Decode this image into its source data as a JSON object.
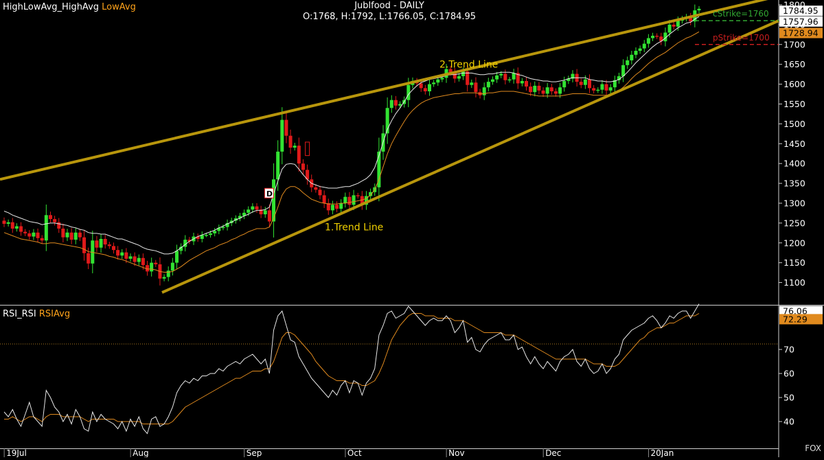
{
  "header": {
    "indicator_a": "HighLowAvg_HighAvg",
    "indicator_b": "LowAvg",
    "title": "Jublfood - DAILY",
    "ohlc": "O:1768, H:1792, L:1766.05, C:1784.95"
  },
  "rsi_panel": {
    "indicator_a": "RSI_RSI",
    "indicator_b": "RSIAvg"
  },
  "watermark": "FOX",
  "colors": {
    "background": "#000000",
    "bull": "#32e332",
    "bear": "#e01a1a",
    "trend_line": "#b8960c",
    "high_avg": "#e8e8e8",
    "low_avg": "#e08a1e",
    "rsi": "#e8e8e8",
    "rsi_avg": "#e08a1e",
    "call_strike": "#32a832",
    "put_strike": "#c81e1e"
  },
  "chart_data": [
    {
      "type": "candlestick",
      "title": "Jublfood - DAILY",
      "x_ticks": [
        "19Jul",
        "Aug",
        "Sep",
        "Oct",
        "Nov",
        "Dec",
        "20Jan"
      ],
      "y_ticks": [
        1100,
        1150,
        1200,
        1250,
        1300,
        1350,
        1400,
        1450,
        1500,
        1550,
        1600,
        1650,
        1700,
        1750,
        1800
      ],
      "ylim": [
        1064,
        1810
      ],
      "grid": false,
      "close_series": [
        1248,
        1252,
        1236,
        1242,
        1228,
        1224,
        1216,
        1226,
        1212,
        1206,
        1270,
        1260,
        1252,
        1236,
        1214,
        1226,
        1208,
        1226,
        1214,
        1174,
        1148,
        1206,
        1188,
        1210,
        1196,
        1192,
        1182,
        1168,
        1176,
        1160,
        1166,
        1152,
        1162,
        1144,
        1128,
        1150,
        1146,
        1110,
        1114,
        1130,
        1150,
        1180,
        1190,
        1208,
        1204,
        1216,
        1210,
        1220,
        1220,
        1224,
        1230,
        1238,
        1240,
        1250,
        1256,
        1262,
        1268,
        1276,
        1284,
        1292,
        1284,
        1272,
        1282,
        1254,
        1360,
        1430,
        1510,
        1470,
        1440,
        1445,
        1400,
        1384,
        1360,
        1340,
        1334,
        1320,
        1300,
        1282,
        1296,
        1286,
        1300,
        1316,
        1296,
        1320,
        1318,
        1296,
        1318,
        1328,
        1340,
        1430,
        1476,
        1540,
        1560,
        1546,
        1550,
        1560,
        1598,
        1608,
        1602,
        1590,
        1582,
        1600,
        1604,
        1612,
        1616,
        1638,
        1630,
        1614,
        1620,
        1632,
        1598,
        1604,
        1580,
        1572,
        1592,
        1606,
        1612,
        1622,
        1626,
        1610,
        1612,
        1628,
        1602,
        1608,
        1594,
        1580,
        1596,
        1584,
        1576,
        1592,
        1582,
        1576,
        1592,
        1608,
        1614,
        1626,
        1606,
        1598,
        1612,
        1590,
        1584,
        1586,
        1600,
        1584,
        1592,
        1610,
        1620,
        1648,
        1660,
        1674,
        1684,
        1690,
        1702,
        1716,
        1722,
        1720,
        1708,
        1730,
        1750,
        1745,
        1760,
        1765,
        1770,
        1758,
        1786,
        1790
      ],
      "high_avg": [
        1280,
        1276,
        1270,
        1266,
        1262,
        1258,
        1254,
        1252,
        1250,
        1246,
        1248,
        1250,
        1250,
        1248,
        1246,
        1244,
        1240,
        1238,
        1234,
        1232,
        1226,
        1224,
        1224,
        1222,
        1222,
        1218,
        1214,
        1210,
        1210,
        1206,
        1202,
        1198,
        1194,
        1188,
        1184,
        1182,
        1180,
        1176,
        1172,
        1172,
        1174,
        1180,
        1188,
        1196,
        1204,
        1210,
        1216,
        1220,
        1224,
        1228,
        1232,
        1238,
        1242,
        1248,
        1252,
        1258,
        1262,
        1268,
        1272,
        1278,
        1282,
        1282,
        1284,
        1290,
        1324,
        1356,
        1386,
        1398,
        1400,
        1398,
        1386,
        1372,
        1360,
        1350,
        1346,
        1342,
        1340,
        1338,
        1338,
        1338,
        1340,
        1342,
        1342,
        1346,
        1350,
        1356,
        1362,
        1372,
        1390,
        1420,
        1454,
        1486,
        1508,
        1526,
        1540,
        1556,
        1574,
        1586,
        1596,
        1604,
        1608,
        1612,
        1614,
        1616,
        1618,
        1622,
        1624,
        1624,
        1626,
        1628,
        1628,
        1628,
        1626,
        1624,
        1624,
        1626,
        1626,
        1628,
        1630,
        1630,
        1630,
        1628,
        1624,
        1622,
        1618,
        1614,
        1612,
        1610,
        1608,
        1608,
        1606,
        1606,
        1608,
        1610,
        1614,
        1616,
        1616,
        1616,
        1616,
        1612,
        1610,
        1608,
        1608,
        1606,
        1606,
        1608,
        1612,
        1620,
        1630,
        1642,
        1654,
        1664,
        1674,
        1684,
        1694,
        1702,
        1708,
        1716,
        1726,
        1734,
        1742,
        1748,
        1754,
        1756,
        1764,
        1770
      ],
      "low_avg": [
        1226,
        1222,
        1218,
        1214,
        1210,
        1208,
        1206,
        1204,
        1202,
        1198,
        1198,
        1200,
        1200,
        1198,
        1196,
        1194,
        1192,
        1190,
        1188,
        1184,
        1178,
        1176,
        1174,
        1172,
        1170,
        1166,
        1164,
        1160,
        1158,
        1154,
        1150,
        1146,
        1142,
        1138,
        1134,
        1134,
        1132,
        1128,
        1126,
        1126,
        1128,
        1134,
        1140,
        1148,
        1156,
        1162,
        1168,
        1174,
        1180,
        1184,
        1188,
        1194,
        1198,
        1202,
        1208,
        1212,
        1218,
        1222,
        1228,
        1232,
        1236,
        1236,
        1236,
        1240,
        1262,
        1290,
        1320,
        1336,
        1342,
        1342,
        1336,
        1326,
        1318,
        1310,
        1306,
        1302,
        1300,
        1298,
        1298,
        1298,
        1300,
        1300,
        1302,
        1304,
        1306,
        1308,
        1312,
        1320,
        1334,
        1360,
        1392,
        1424,
        1450,
        1470,
        1488,
        1506,
        1522,
        1534,
        1544,
        1552,
        1558,
        1562,
        1566,
        1568,
        1570,
        1572,
        1574,
        1576,
        1576,
        1578,
        1578,
        1578,
        1578,
        1576,
        1576,
        1578,
        1578,
        1580,
        1582,
        1582,
        1582,
        1582,
        1580,
        1578,
        1576,
        1574,
        1572,
        1570,
        1570,
        1570,
        1570,
        1570,
        1570,
        1572,
        1574,
        1576,
        1576,
        1576,
        1576,
        1574,
        1572,
        1572,
        1572,
        1572,
        1574,
        1578,
        1584,
        1592,
        1602,
        1614,
        1624,
        1632,
        1642,
        1652,
        1660,
        1668,
        1674,
        1680,
        1688,
        1696,
        1704,
        1710,
        1716,
        1720,
        1726,
        1732
      ]
    },
    {
      "type": "line",
      "series_a": "RSI_RSI",
      "series_b": "RSIAvg",
      "y_ticks": [
        40,
        50,
        60,
        70
      ],
      "ylim": [
        34,
        88
      ],
      "reference_level": 72.29,
      "rsi": [
        44,
        42,
        45,
        41,
        38,
        43,
        48,
        42,
        40,
        38,
        53,
        50,
        46,
        44,
        40,
        43,
        39,
        45,
        42,
        37,
        36,
        44,
        40,
        43,
        41,
        40,
        39,
        37,
        40,
        36,
        41,
        38,
        42,
        37,
        35,
        41,
        42,
        38,
        39,
        42,
        46,
        52,
        55,
        57,
        56,
        58,
        57,
        59,
        59,
        60,
        60,
        62,
        61,
        63,
        64,
        65,
        64,
        66,
        67,
        68,
        66,
        64,
        66,
        60,
        78,
        84,
        86,
        80,
        74,
        73,
        67,
        64,
        61,
        58,
        56,
        54,
        52,
        50,
        53,
        51,
        55,
        57,
        52,
        57,
        56,
        51,
        56,
        58,
        62,
        76,
        80,
        85,
        86,
        83,
        84,
        85,
        88,
        86,
        84,
        82,
        80,
        82,
        83,
        82,
        82,
        84,
        82,
        77,
        79,
        82,
        73,
        75,
        70,
        69,
        72,
        74,
        75,
        76,
        77,
        74,
        74,
        76,
        70,
        71,
        67,
        64,
        67,
        64,
        62,
        65,
        63,
        61,
        65,
        67,
        68,
        70,
        65,
        63,
        66,
        62,
        60,
        61,
        64,
        60,
        62,
        66,
        68,
        74,
        76,
        78,
        79,
        80,
        81,
        83,
        84,
        82,
        79,
        81,
        84,
        83,
        85,
        86,
        86,
        83,
        86,
        89
      ],
      "rsi_avg": [
        41,
        41,
        42,
        41,
        40,
        41,
        42,
        42,
        41,
        40,
        42,
        43,
        43,
        43,
        42,
        42,
        42,
        42,
        42,
        41,
        40,
        41,
        41,
        41,
        41,
        41,
        41,
        40,
        40,
        40,
        40,
        40,
        40,
        39,
        39,
        39,
        39,
        39,
        39,
        39,
        40,
        42,
        44,
        46,
        47,
        48,
        49,
        50,
        51,
        52,
        53,
        54,
        55,
        56,
        57,
        58,
        58,
        59,
        60,
        61,
        61,
        61,
        62,
        62,
        65,
        70,
        75,
        77,
        77,
        76,
        74,
        72,
        70,
        68,
        65,
        63,
        61,
        59,
        58,
        57,
        57,
        57,
        56,
        56,
        56,
        55,
        55,
        56,
        57,
        60,
        64,
        69,
        74,
        77,
        80,
        82,
        84,
        85,
        85,
        85,
        84,
        84,
        84,
        83,
        83,
        83,
        83,
        82,
        82,
        82,
        81,
        80,
        79,
        78,
        77,
        77,
        77,
        77,
        77,
        76,
        76,
        76,
        75,
        74,
        73,
        72,
        71,
        70,
        69,
        68,
        67,
        66,
        66,
        66,
        66,
        66,
        66,
        66,
        66,
        65,
        64,
        64,
        64,
        63,
        63,
        63,
        64,
        66,
        68,
        70,
        72,
        74,
        75,
        77,
        78,
        79,
        79,
        80,
        81,
        81,
        82,
        83,
        84,
        84,
        84,
        85
      ]
    }
  ],
  "annotations": {
    "trend_line_1": "1.Trend Line",
    "trend_line_2": "2.Trend Line",
    "marker": "D",
    "call_strike_label": "cStrike=1760",
    "put_strike_label": "pStrike=1700",
    "call_strike_value": 1760,
    "put_strike_value": 1700
  },
  "price_tags": {
    "close": "1784.95",
    "high_avg": "1757.96",
    "low_avg": "1728.94"
  },
  "rsi_tags": {
    "rsi": "76.06",
    "rsi_avg": "72.29"
  }
}
